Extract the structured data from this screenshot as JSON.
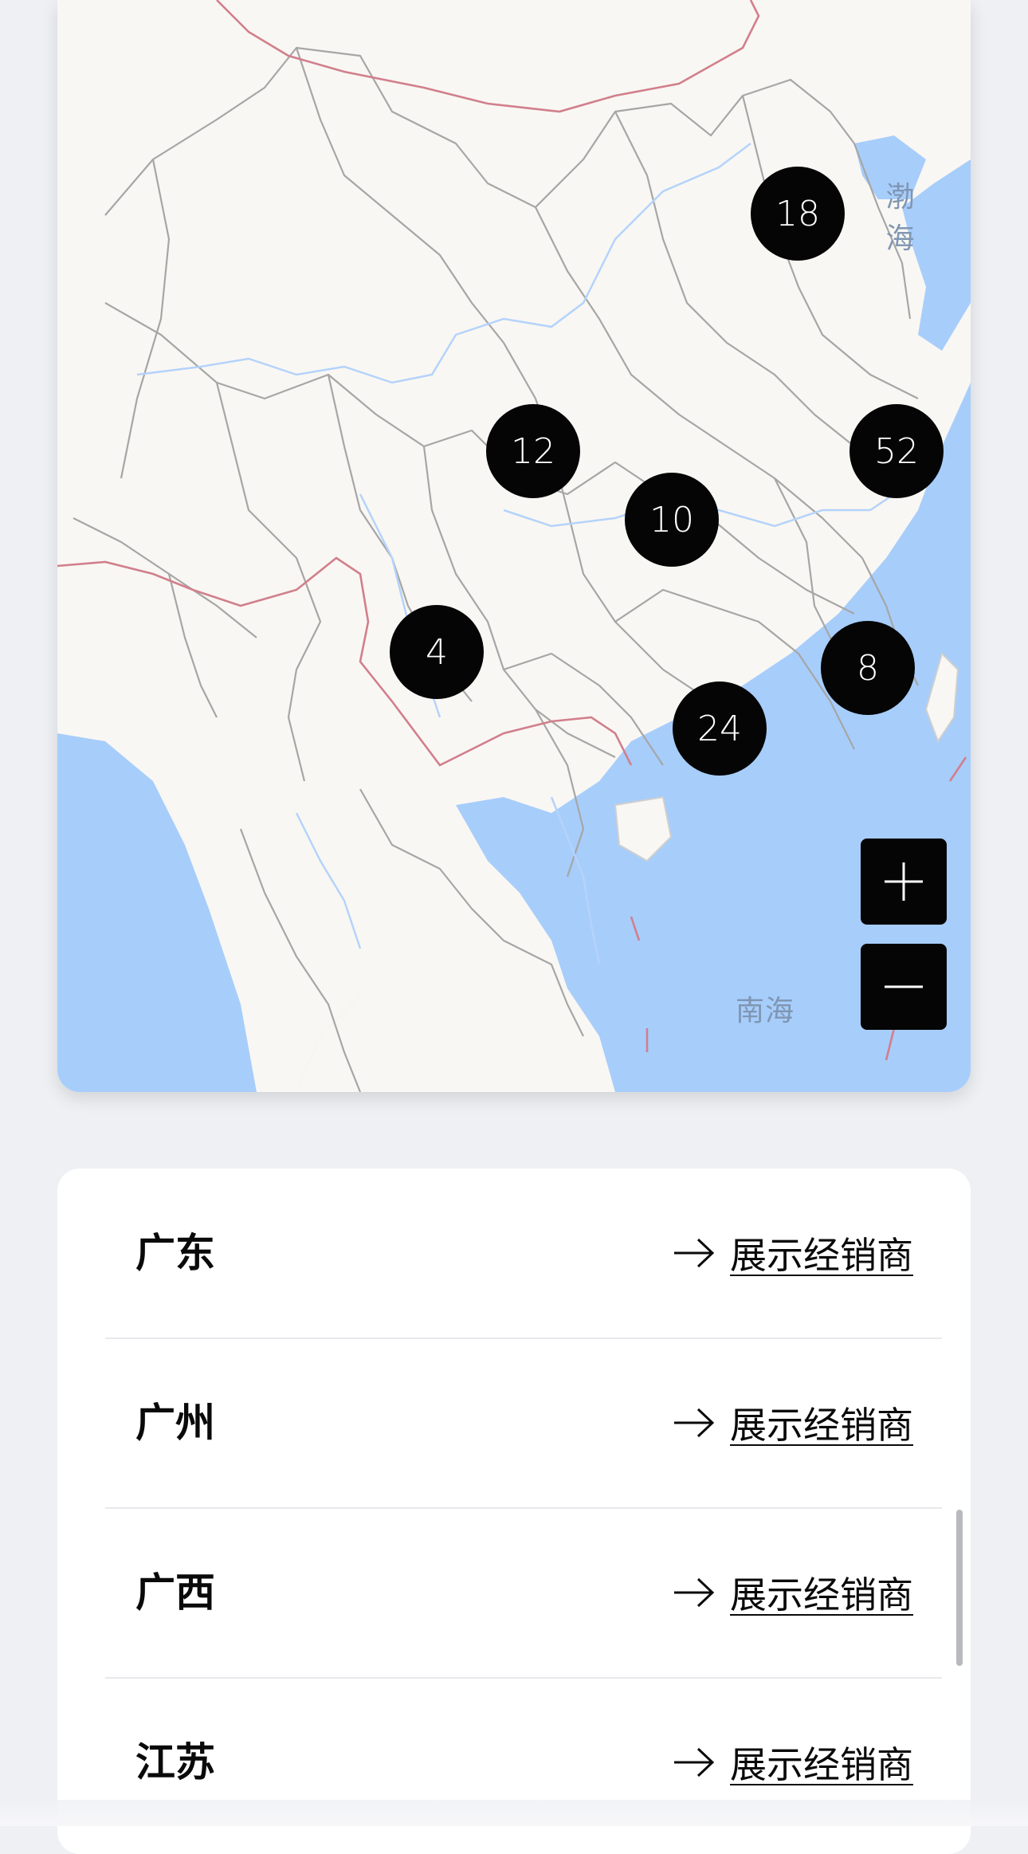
{
  "map": {
    "clusters": [
      {
        "count": "18"
      },
      {
        "count": "12"
      },
      {
        "count": "52"
      },
      {
        "count": "10"
      },
      {
        "count": "4"
      },
      {
        "count": "8"
      },
      {
        "count": "24"
      }
    ],
    "sea_labels": {
      "bohai": "渤海",
      "nanhai": "南海"
    },
    "zoom_in_icon": "plus-icon",
    "zoom_out_icon": "minus-icon",
    "colors": {
      "land": "#f9f7f3",
      "water": "#a7cdfb",
      "border": "#a6a6a6",
      "national_border": "#d17f8c",
      "cluster": "#050505"
    }
  },
  "list": {
    "action_icon": "arrow-right-icon",
    "rows": [
      {
        "name": "广东",
        "action": "展示经销商"
      },
      {
        "name": "广州",
        "action": "展示经销商"
      },
      {
        "name": "广西",
        "action": "展示经销商"
      },
      {
        "name": "江苏",
        "action": "展示经销商"
      }
    ]
  }
}
